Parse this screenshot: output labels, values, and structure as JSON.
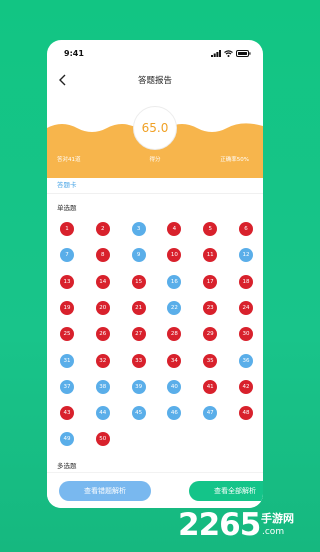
{
  "status": {
    "time": "9:41"
  },
  "nav": {
    "title": "答题报告"
  },
  "score": {
    "value": "65.0",
    "correct_label": "答对41道",
    "score_label": "得分",
    "accuracy_label": "正确率50%"
  },
  "card_link": "答题卡",
  "single": {
    "title": "单选题",
    "questions": [
      {
        "n": "1",
        "s": "wrong"
      },
      {
        "n": "2",
        "s": "wrong"
      },
      {
        "n": "3",
        "s": "right"
      },
      {
        "n": "4",
        "s": "wrong"
      },
      {
        "n": "5",
        "s": "wrong"
      },
      {
        "n": "6",
        "s": "wrong"
      },
      {
        "n": "7",
        "s": "right"
      },
      {
        "n": "8",
        "s": "wrong"
      },
      {
        "n": "9",
        "s": "right"
      },
      {
        "n": "10",
        "s": "wrong"
      },
      {
        "n": "11",
        "s": "wrong"
      },
      {
        "n": "12",
        "s": "right"
      },
      {
        "n": "13",
        "s": "wrong"
      },
      {
        "n": "14",
        "s": "wrong"
      },
      {
        "n": "15",
        "s": "wrong"
      },
      {
        "n": "16",
        "s": "right"
      },
      {
        "n": "17",
        "s": "wrong"
      },
      {
        "n": "18",
        "s": "wrong"
      },
      {
        "n": "19",
        "s": "wrong"
      },
      {
        "n": "20",
        "s": "wrong"
      },
      {
        "n": "21",
        "s": "wrong"
      },
      {
        "n": "22",
        "s": "right"
      },
      {
        "n": "23",
        "s": "wrong"
      },
      {
        "n": "24",
        "s": "wrong"
      },
      {
        "n": "25",
        "s": "wrong"
      },
      {
        "n": "26",
        "s": "wrong"
      },
      {
        "n": "27",
        "s": "wrong"
      },
      {
        "n": "28",
        "s": "wrong"
      },
      {
        "n": "29",
        "s": "wrong"
      },
      {
        "n": "30",
        "s": "wrong"
      },
      {
        "n": "31",
        "s": "right"
      },
      {
        "n": "32",
        "s": "wrong"
      },
      {
        "n": "33",
        "s": "wrong"
      },
      {
        "n": "34",
        "s": "wrong"
      },
      {
        "n": "35",
        "s": "wrong"
      },
      {
        "n": "36",
        "s": "right"
      },
      {
        "n": "37",
        "s": "right"
      },
      {
        "n": "38",
        "s": "right"
      },
      {
        "n": "39",
        "s": "right"
      },
      {
        "n": "40",
        "s": "right"
      },
      {
        "n": "41",
        "s": "wrong"
      },
      {
        "n": "42",
        "s": "wrong"
      },
      {
        "n": "43",
        "s": "wrong"
      },
      {
        "n": "44",
        "s": "right"
      },
      {
        "n": "45",
        "s": "right"
      },
      {
        "n": "46",
        "s": "right"
      },
      {
        "n": "47",
        "s": "right"
      },
      {
        "n": "48",
        "s": "wrong"
      },
      {
        "n": "49",
        "s": "right"
      },
      {
        "n": "50",
        "s": "wrong"
      }
    ]
  },
  "multi": {
    "title": "多选题"
  },
  "buttons": {
    "wrong_analysis": "查看错题解析",
    "all_analysis": "查看全部解析"
  },
  "colors": {
    "wrong": "#d8212c",
    "right": "#5aaee9",
    "accent": "#f7b54c",
    "green": "#14c489"
  },
  "watermark": {
    "digits": "2265",
    "cn": "手游网",
    "domain": ".com"
  }
}
